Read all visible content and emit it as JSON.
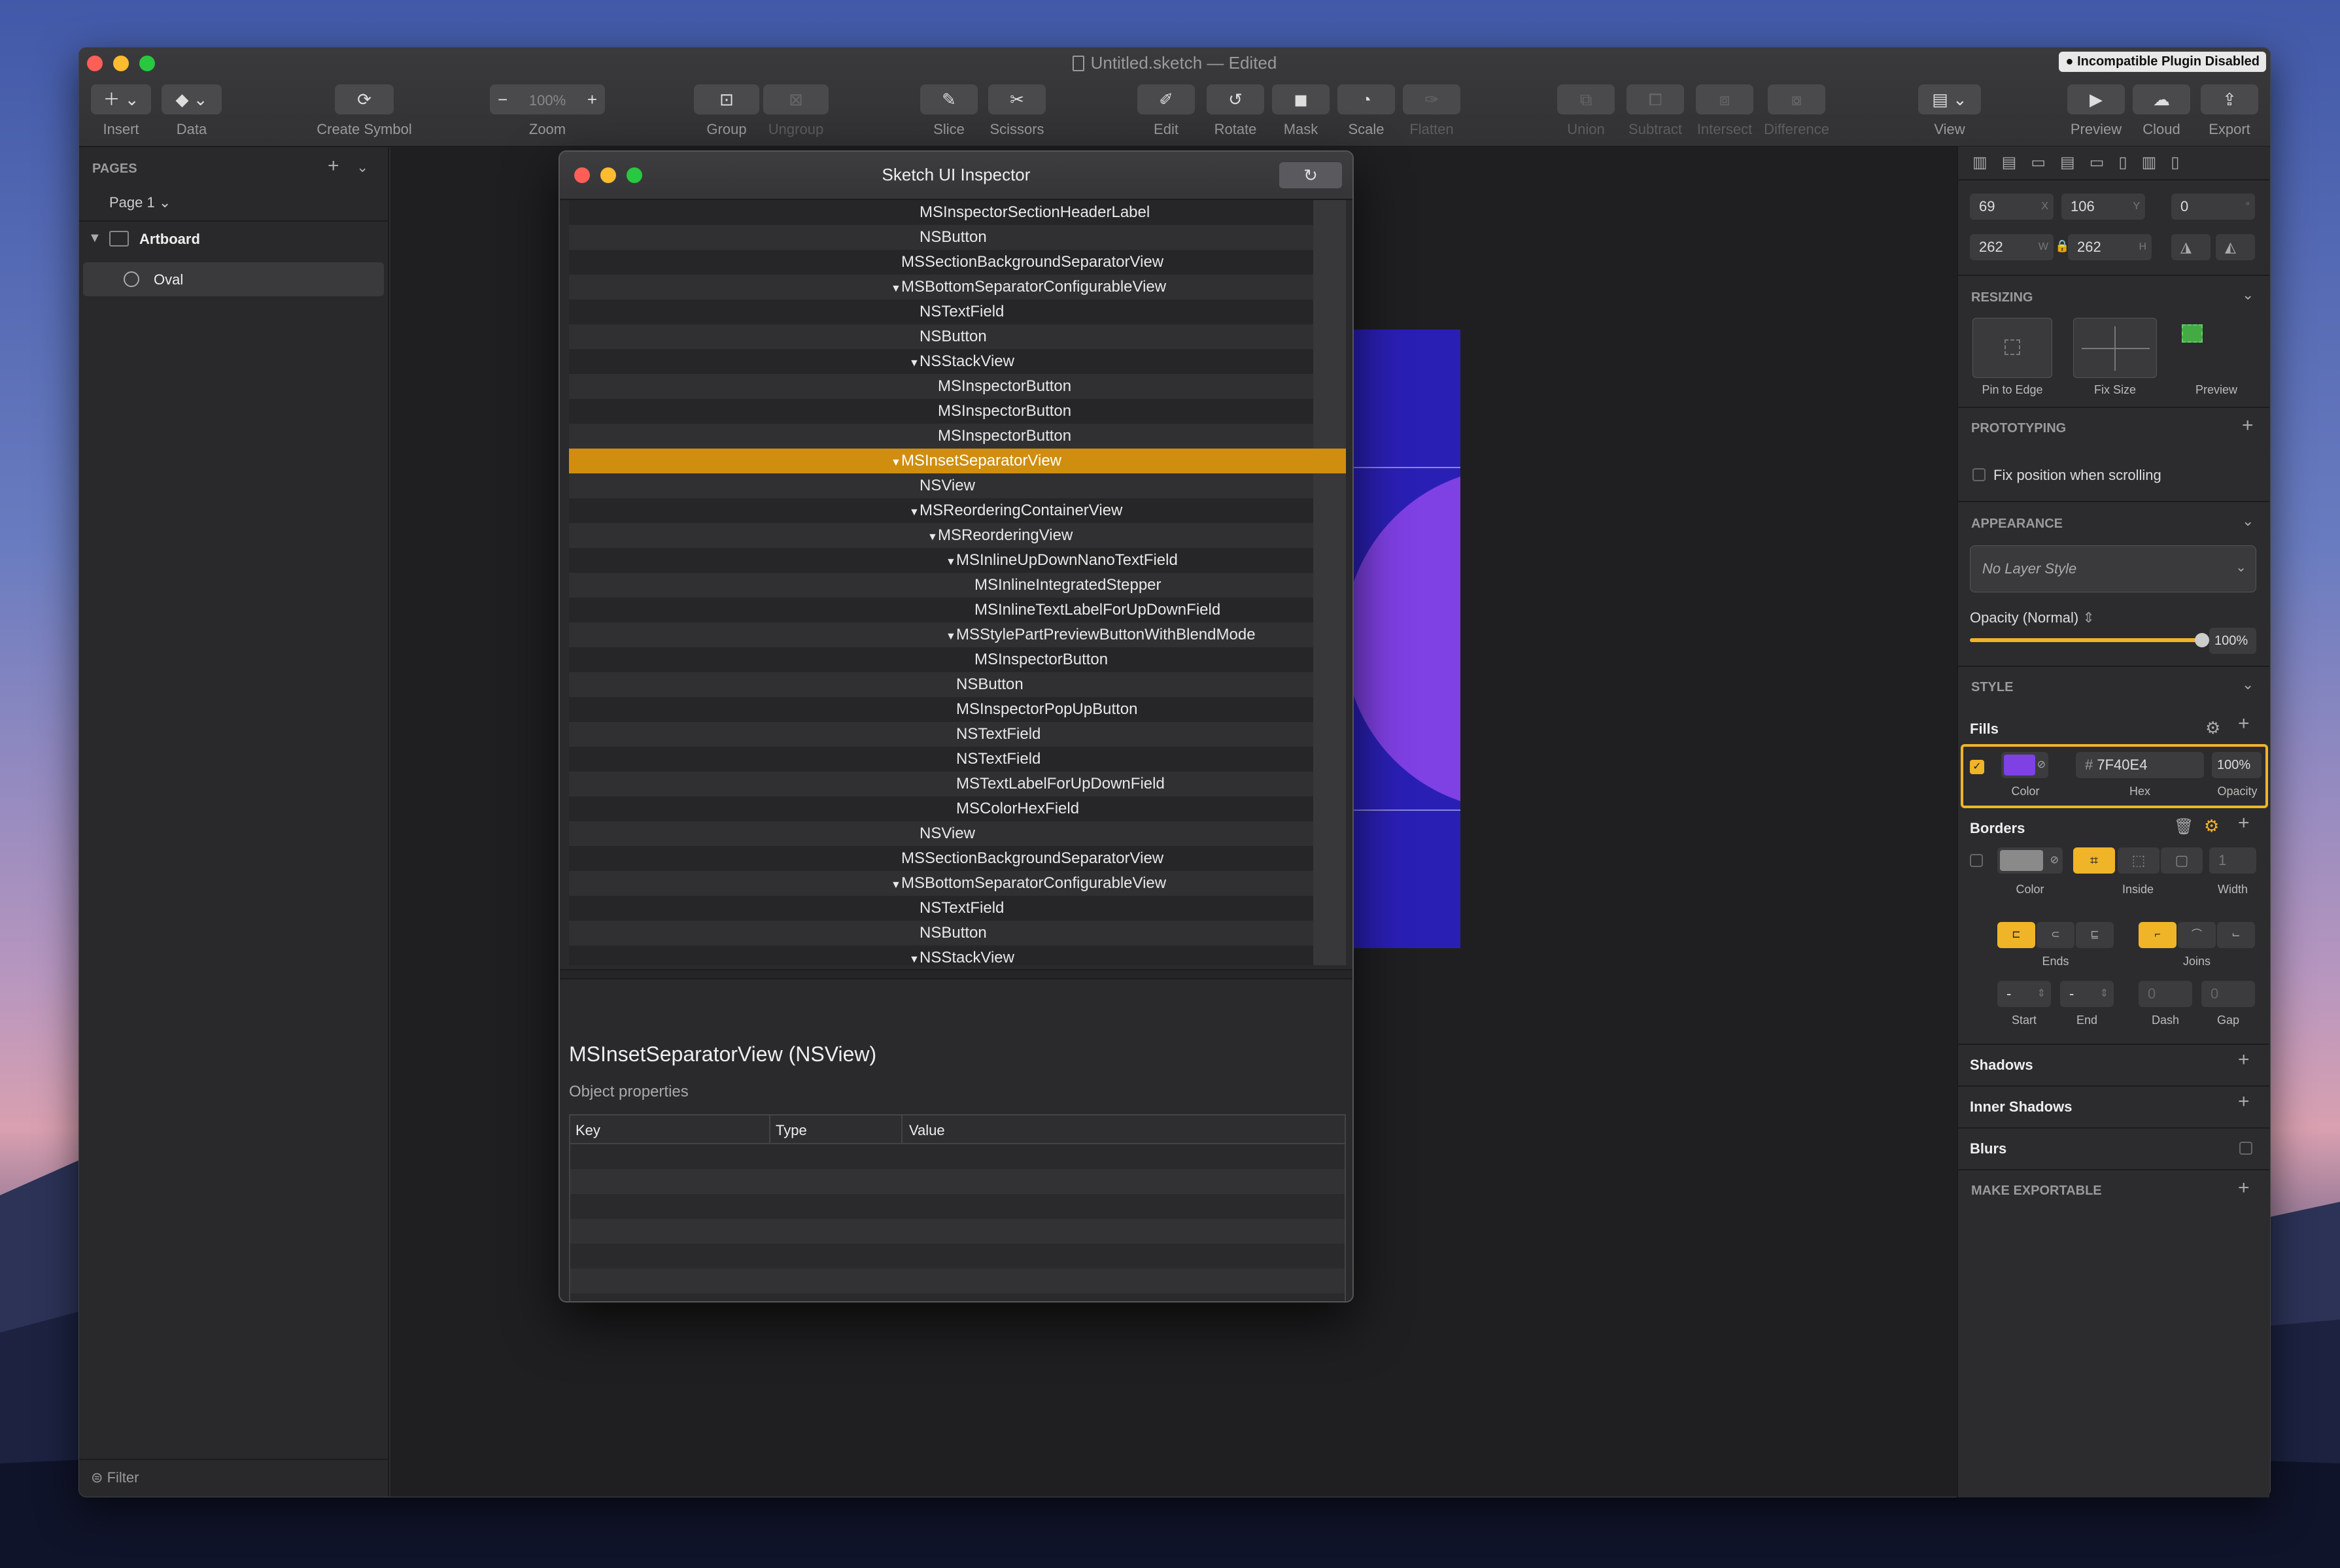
{
  "window": {
    "title": "Untitled.sketch — Edited",
    "badge": "Incompatible Plugin Disabled"
  },
  "toolbar": {
    "insert": "Insert",
    "data": "Data",
    "create_symbol": "Create Symbol",
    "zoom_value": "100%",
    "zoom": "Zoom",
    "group": "Group",
    "ungroup": "Ungroup",
    "slice": "Slice",
    "scissors": "Scissors",
    "edit": "Edit",
    "rotate": "Rotate",
    "mask": "Mask",
    "scale": "Scale",
    "flatten": "Flatten",
    "union": "Union",
    "subtract": "Subtract",
    "intersect": "Intersect",
    "difference": "Difference",
    "view": "View",
    "preview": "Preview",
    "cloud": "Cloud",
    "export": "Export"
  },
  "sidebar": {
    "pages_header": "PAGES",
    "page_selector": "Page 1",
    "artboard": "Artboard",
    "layer": "Oval",
    "filter": "Filter"
  },
  "inspector": {
    "x": "69",
    "x_suffix": "X",
    "y": "106",
    "y_suffix": "Y",
    "rotation": "0",
    "rotation_suffix": "°",
    "w": "262",
    "w_suffix": "W",
    "h": "262",
    "h_suffix": "H",
    "resizing": "RESIZING",
    "pin_to_edge": "Pin to Edge",
    "fix_size": "Fix Size",
    "preview": "Preview",
    "prototyping": "PROTOTYPING",
    "fix_position": "Fix position when scrolling",
    "appearance": "APPEARANCE",
    "layer_style": "No Layer Style",
    "opacity_label": "Opacity (Normal)",
    "opacity": "100%",
    "opacity_level": 1.0,
    "style": "STYLE",
    "fills": "Fills",
    "fill_hex": "7F40E4",
    "fill_hex_prefix": "#",
    "fill_opacity": "100%",
    "fill_color_label": "Color",
    "fill_hex_label": "Hex",
    "fill_opacity_label": "Opacity",
    "fill_color": "#7f40e4",
    "borders": "Borders",
    "border_color_label": "Color",
    "border_position_label": "Inside",
    "border_width_label": "Width",
    "border_width": "1",
    "ends": "Ends",
    "joins": "Joins",
    "start": "Start",
    "end": "End",
    "dash": "Dash",
    "gap": "Gap",
    "start_value": "-",
    "end_value": "-",
    "dash_value": "0",
    "gap_value": "0",
    "shadows": "Shadows",
    "inner_shadows": "Inner Shadows",
    "blurs": "Blurs",
    "make_exportable": "MAKE EXPORTABLE"
  },
  "dialog": {
    "title": "Sketch UI Inspector",
    "rows": [
      {
        "label": "MSInspectorSectionHeaderLabel",
        "depth": 2,
        "tri": ""
      },
      {
        "label": "NSButton",
        "depth": 2,
        "tri": ""
      },
      {
        "label": "MSSectionBackgroundSeparatorView",
        "depth": 1,
        "tri": ""
      },
      {
        "label": "MSBottomSeparatorConfigurableView",
        "depth": 1,
        "tri": "▼"
      },
      {
        "label": "NSTextField",
        "depth": 2,
        "tri": ""
      },
      {
        "label": "NSButton",
        "depth": 2,
        "tri": ""
      },
      {
        "label": "NSStackView",
        "depth": 2,
        "tri": "▼"
      },
      {
        "label": "MSInspectorButton",
        "depth": 3,
        "tri": ""
      },
      {
        "label": "MSInspectorButton",
        "depth": 3,
        "tri": ""
      },
      {
        "label": "MSInspectorButton",
        "depth": 3,
        "tri": ""
      },
      {
        "label": "MSInsetSeparatorView",
        "depth": 1,
        "tri": "▼",
        "selected": true
      },
      {
        "label": "NSView",
        "depth": 2,
        "tri": ""
      },
      {
        "label": "MSReorderingContainerView",
        "depth": 2,
        "tri": "▼"
      },
      {
        "label": "MSReorderingView",
        "depth": 3,
        "tri": "▼"
      },
      {
        "label": "MSInlineUpDownNanoTextField",
        "depth": 4,
        "tri": "▼"
      },
      {
        "label": "MSInlineIntegratedStepper",
        "depth": 5,
        "tri": ""
      },
      {
        "label": "MSInlineTextLabelForUpDownField",
        "depth": 5,
        "tri": ""
      },
      {
        "label": "MSStylePartPreviewButtonWithBlendMode",
        "depth": 4,
        "tri": "▼"
      },
      {
        "label": "MSInspectorButton",
        "depth": 5,
        "tri": ""
      },
      {
        "label": "NSButton",
        "depth": 4,
        "tri": ""
      },
      {
        "label": "MSInspectorPopUpButton",
        "depth": 4,
        "tri": ""
      },
      {
        "label": "NSTextField",
        "depth": 4,
        "tri": ""
      },
      {
        "label": "NSTextField",
        "depth": 4,
        "tri": ""
      },
      {
        "label": "MSTextLabelForUpDownField",
        "depth": 4,
        "tri": ""
      },
      {
        "label": "MSColorHexField",
        "depth": 4,
        "tri": ""
      },
      {
        "label": "NSView",
        "depth": 2,
        "tri": ""
      },
      {
        "label": "MSSectionBackgroundSeparatorView",
        "depth": 1,
        "tri": ""
      },
      {
        "label": "MSBottomSeparatorConfigurableView",
        "depth": 1,
        "tri": "▼"
      },
      {
        "label": "NSTextField",
        "depth": 2,
        "tri": ""
      },
      {
        "label": "NSButton",
        "depth": 2,
        "tri": ""
      },
      {
        "label": "NSStackView",
        "depth": 2,
        "tri": "▼"
      }
    ],
    "detail_title": "MSInsetSeparatorView (NSView)",
    "object_properties": "Object properties",
    "columns": [
      "Key",
      "Type",
      "Value"
    ]
  }
}
